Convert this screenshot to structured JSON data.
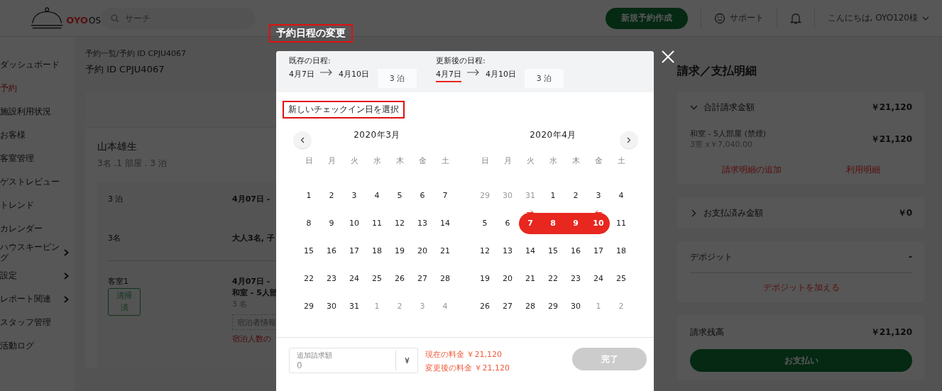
{
  "header": {
    "logo": {
      "brand": "OYO",
      "suffix": "OS"
    },
    "search": {
      "placeholder": "サーチ"
    },
    "new_booking_button": "新規予約作成",
    "support": "サポート",
    "greeting": "こんにちは, OYO120様"
  },
  "sidebar": {
    "items": [
      {
        "label": "ダッシュボード",
        "selected": false,
        "expandable": false
      },
      {
        "label": "予約",
        "selected": true,
        "expandable": false
      },
      {
        "label": "施設利用状況",
        "selected": false,
        "expandable": false
      },
      {
        "label": "お客様",
        "selected": false,
        "expandable": false
      },
      {
        "label": "客室管理",
        "selected": false,
        "expandable": false
      },
      {
        "label": "ゲストレビュー",
        "selected": false,
        "expandable": false
      },
      {
        "label": "トレンド",
        "selected": false,
        "expandable": false
      },
      {
        "label": "カレンダー",
        "selected": false,
        "expandable": false
      },
      {
        "label": "ハウスキーピング",
        "selected": false,
        "expandable": true
      },
      {
        "label": "設定",
        "selected": false,
        "expandable": true
      },
      {
        "label": "レポート関連",
        "selected": false,
        "expandable": true
      },
      {
        "label": "スタッフ管理",
        "selected": false,
        "expandable": false
      },
      {
        "label": "活動ログ",
        "selected": false,
        "expandable": false
      }
    ]
  },
  "booking": {
    "breadcrumb": "予約一覧/予約 ID CPJU4067",
    "title": "予約 ID CPJU4067",
    "guest_name": "山本雄生",
    "summary": "3名 .1 部屋 . 3 泊",
    "rows": [
      {
        "label": "3 泊",
        "value": "4月07日 -"
      },
      {
        "label": "3名",
        "value": "大人3名, 子"
      }
    ],
    "room": {
      "label": "客室1",
      "status": "清掃済",
      "dates": "4月07日 -",
      "type": "和室 - 5人部",
      "guests": "3 名",
      "guest_info_placeholder": "宿泊者情報",
      "change_link": "宿泊人数の"
    }
  },
  "billing": {
    "title": "請求／支払明細",
    "total": {
      "label": "合計請求金額",
      "amount": "￥21,120",
      "expanded": true,
      "item": {
        "name": "和室 - 5人部屋 (禁煙)",
        "detail": "3室 x￥7,040.00",
        "amount": "￥21,120"
      },
      "links": [
        "請求明細の追加",
        "利用明細"
      ]
    },
    "paid": {
      "label": "お支払済み金額",
      "amount": "￥0",
      "expanded": false
    },
    "deposit": {
      "label": "デポジット",
      "value": "-",
      "link": "デポジットを加える"
    },
    "balance": {
      "label": "請求残高",
      "amount": "￥21,120",
      "button": "お支払い"
    }
  },
  "modal": {
    "title": "予約日程の変更",
    "schedules": [
      {
        "label": "既存の日程:",
        "from": {
          "text": "4月7日",
          "active": false
        },
        "to": "4月10日",
        "nights": "3 泊"
      },
      {
        "label": "更新後の日程:",
        "from": {
          "text": "4月7日",
          "active": true
        },
        "to": "4月10日",
        "nights": "3 泊"
      }
    ],
    "prompt": "新しいチェックイン日を選択",
    "calendars": [
      {
        "title": "2020年3月",
        "weekdays": [
          "日",
          "月",
          "火",
          "水",
          "木",
          "金",
          "土"
        ],
        "days": [
          {
            "d": "1",
            "muted": false,
            "selected": false
          },
          {
            "d": "2",
            "muted": false,
            "selected": false
          },
          {
            "d": "3",
            "muted": false,
            "selected": false
          },
          {
            "d": "4",
            "muted": false,
            "selected": false
          },
          {
            "d": "5",
            "muted": false,
            "selected": false
          },
          {
            "d": "6",
            "muted": false,
            "selected": false
          },
          {
            "d": "7",
            "muted": false,
            "selected": false
          },
          {
            "d": "8",
            "muted": false,
            "selected": false
          },
          {
            "d": "9",
            "muted": false,
            "selected": false
          },
          {
            "d": "10",
            "muted": false,
            "selected": false
          },
          {
            "d": "11",
            "muted": false,
            "selected": false
          },
          {
            "d": "12",
            "muted": false,
            "selected": false
          },
          {
            "d": "13",
            "muted": false,
            "selected": false
          },
          {
            "d": "14",
            "muted": false,
            "selected": false
          },
          {
            "d": "15",
            "muted": false,
            "selected": false
          },
          {
            "d": "16",
            "muted": false,
            "selected": false
          },
          {
            "d": "17",
            "muted": false,
            "selected": false
          },
          {
            "d": "18",
            "muted": false,
            "selected": false
          },
          {
            "d": "19",
            "muted": false,
            "selected": false
          },
          {
            "d": "20",
            "muted": false,
            "selected": false
          },
          {
            "d": "21",
            "muted": false,
            "selected": false
          },
          {
            "d": "22",
            "muted": false,
            "selected": false
          },
          {
            "d": "23",
            "muted": false,
            "selected": false
          },
          {
            "d": "24",
            "muted": false,
            "selected": false
          },
          {
            "d": "25",
            "muted": false,
            "selected": false
          },
          {
            "d": "26",
            "muted": false,
            "selected": false
          },
          {
            "d": "27",
            "muted": false,
            "selected": false
          },
          {
            "d": "28",
            "muted": false,
            "selected": false
          },
          {
            "d": "29",
            "muted": false,
            "selected": false
          },
          {
            "d": "30",
            "muted": false,
            "selected": false
          },
          {
            "d": "31",
            "muted": false,
            "selected": false
          },
          {
            "d": "1",
            "muted": true,
            "selected": false
          },
          {
            "d": "2",
            "muted": true,
            "selected": false
          },
          {
            "d": "3",
            "muted": true,
            "selected": false
          },
          {
            "d": "4",
            "muted": true,
            "selected": false
          }
        ]
      },
      {
        "title": "2020年4月",
        "weekdays": [
          "日",
          "月",
          "火",
          "水",
          "木",
          "金",
          "土"
        ],
        "days": [
          {
            "d": "29",
            "muted": true,
            "selected": false
          },
          {
            "d": "30",
            "muted": true,
            "selected": false
          },
          {
            "d": "31",
            "muted": true,
            "selected": false
          },
          {
            "d": "1",
            "muted": false,
            "selected": false
          },
          {
            "d": "2",
            "muted": false,
            "selected": false
          },
          {
            "d": "3",
            "muted": false,
            "selected": false
          },
          {
            "d": "4",
            "muted": false,
            "selected": false
          },
          {
            "d": "5",
            "muted": false,
            "selected": false
          },
          {
            "d": "6",
            "muted": false,
            "selected": false
          },
          {
            "d": "7",
            "muted": false,
            "selected": true
          },
          {
            "d": "8",
            "muted": false,
            "selected": true
          },
          {
            "d": "9",
            "muted": false,
            "selected": true
          },
          {
            "d": "10",
            "muted": false,
            "selected": true
          },
          {
            "d": "11",
            "muted": false,
            "selected": false
          },
          {
            "d": "12",
            "muted": false,
            "selected": false
          },
          {
            "d": "13",
            "muted": false,
            "selected": false
          },
          {
            "d": "14",
            "muted": false,
            "selected": false
          },
          {
            "d": "15",
            "muted": false,
            "selected": false
          },
          {
            "d": "16",
            "muted": false,
            "selected": false
          },
          {
            "d": "17",
            "muted": false,
            "selected": false
          },
          {
            "d": "18",
            "muted": false,
            "selected": false
          },
          {
            "d": "19",
            "muted": false,
            "selected": false
          },
          {
            "d": "20",
            "muted": false,
            "selected": false
          },
          {
            "d": "21",
            "muted": false,
            "selected": false
          },
          {
            "d": "22",
            "muted": false,
            "selected": false
          },
          {
            "d": "23",
            "muted": false,
            "selected": false
          },
          {
            "d": "24",
            "muted": false,
            "selected": false
          },
          {
            "d": "25",
            "muted": false,
            "selected": false
          },
          {
            "d": "26",
            "muted": false,
            "selected": false
          },
          {
            "d": "27",
            "muted": false,
            "selected": false
          },
          {
            "d": "28",
            "muted": false,
            "selected": false
          },
          {
            "d": "29",
            "muted": false,
            "selected": false
          },
          {
            "d": "30",
            "muted": false,
            "selected": false
          },
          {
            "d": "1",
            "muted": true,
            "selected": false
          },
          {
            "d": "2",
            "muted": true,
            "selected": false
          }
        ]
      }
    ],
    "extra_charge": {
      "label": "追加請求額",
      "value": "0",
      "currency": "¥"
    },
    "prices": [
      "現在の料金 ￥21,120",
      "変更後の料金 ￥21,120"
    ],
    "done_button": {
      "label": "完了",
      "disabled": true
    }
  }
}
